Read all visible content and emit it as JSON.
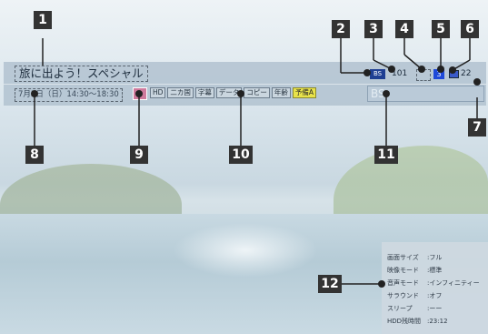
{
  "program": {
    "title": "旅に出よう！スペシャル",
    "datetime": "7月5日（日）14:30〜18:30"
  },
  "status": {
    "bs_tag": "BS",
    "channel": "101",
    "number": "3",
    "mail_count": "22"
  },
  "attributes": [
    "HD",
    "二カ国",
    "字幕",
    "データ",
    "コピー",
    "年齢"
  ],
  "attribute_highlight": "予備A",
  "bs_label": "BS",
  "settings": [
    {
      "label": "画面サイズ",
      "value": ":フル"
    },
    {
      "label": "映像モード",
      "value": ":標準"
    },
    {
      "label": "音声モード",
      "value": ":インフィニティー"
    },
    {
      "label": "サラウンド",
      "value": ":オフ"
    },
    {
      "label": "スリープ",
      "value": ":ーー"
    },
    {
      "label": "HDD残時間",
      "value": ":23:12"
    }
  ],
  "badges": [
    "1",
    "2",
    "3",
    "4",
    "5",
    "6",
    "7",
    "8",
    "9",
    "10",
    "11",
    "12"
  ]
}
